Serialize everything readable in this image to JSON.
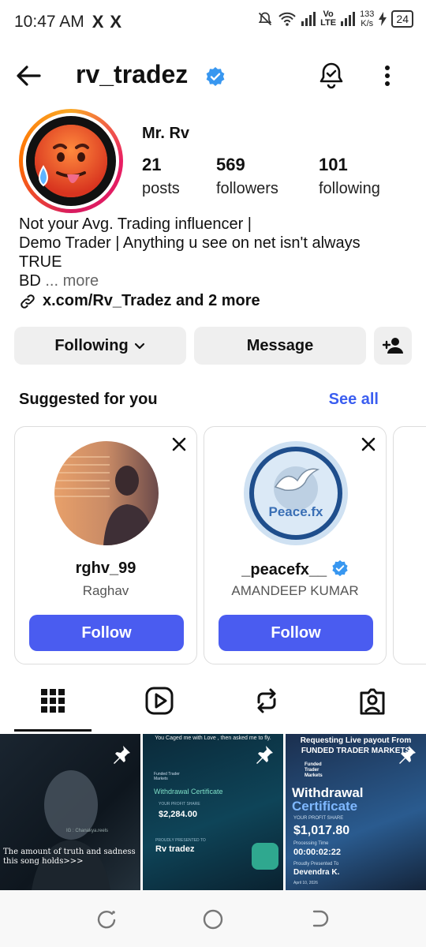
{
  "status_bar": {
    "time": "10:47 AM",
    "x_icons": [
      "X",
      "X"
    ],
    "volte_top": "Vo",
    "volte_bottom": "LTE",
    "speed_value": "133",
    "speed_unit": "K/s",
    "battery": "24"
  },
  "header": {
    "username": "rv_tradez",
    "verified": true
  },
  "profile": {
    "display_name": "Mr. Rv",
    "stats": {
      "posts_count": "21",
      "posts_label": "posts",
      "followers_count": "569",
      "followers_label": "followers",
      "following_count": "101",
      "following_label": "following"
    },
    "bio_line1": "Not your Avg. Trading influencer |",
    "bio_line2": "Demo Trader | Anything u see on net isn't always",
    "bio_line3": "TRUE",
    "bio_line4": "BD",
    "bio_more": "... more",
    "link_text": "x.com/Rv_Tradez and 2 more"
  },
  "actions": {
    "following_label": "Following",
    "message_label": "Message"
  },
  "suggested": {
    "title": "Suggested for you",
    "see_all": "See all",
    "cards": [
      {
        "username": "rghv_99",
        "name": "Raghav",
        "follow_label": "Follow",
        "verified": false
      },
      {
        "username": "_peacefx__",
        "name": "AMANDEEP KUMAR",
        "follow_label": "Follow",
        "verified": true,
        "logo_text": "Peace.fx"
      }
    ]
  },
  "posts": [
    {
      "caption": "The amount of truth and sadness this song holds>>>",
      "watermark": "IG : Chanakya.reels",
      "pinned": true
    },
    {
      "top_text": "You Caged me with Love , then asked me to fly.",
      "brand": "Funded Trader Markets",
      "title": "Withdrawal Certificate",
      "profit_label": "YOUR PROFIT SHARE",
      "amount": "$2,284.00",
      "presented_label": "PROUDLY PRESENTED TO",
      "presented_to": "Rv tradez",
      "pinned": true
    },
    {
      "top_text": "Requesting Live payout From FUNDED TRADER MARKETS",
      "brand": "Funded Trader Markets",
      "title_line1": "Withdrawal",
      "title_line2": "Certificate",
      "profit_label": "YOUR PROFIT SHARE",
      "amount": "$1,017.80",
      "processing_label": "Processing Time",
      "processing_time": "00:00:02:22",
      "presented_label": "Proudly Presented To",
      "presented_to": "Devendra K.",
      "date": "April 10, 2026",
      "pinned": true
    }
  ],
  "colors": {
    "follow_blue": "#4a5cf0",
    "link_blue": "#3b5ef0",
    "verified_blue": "#3897f0"
  }
}
